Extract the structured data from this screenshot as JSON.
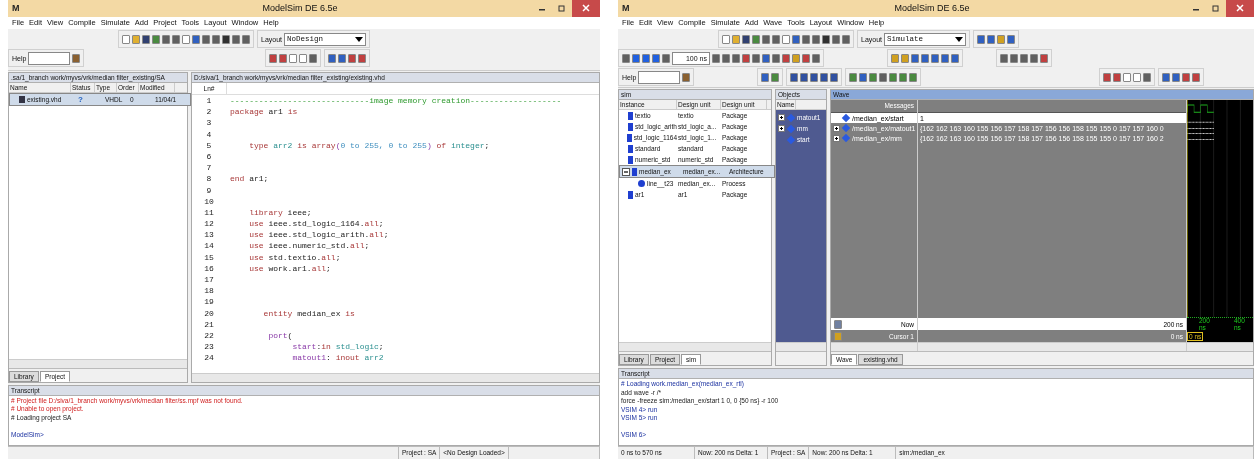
{
  "left": {
    "window": {
      "logo": "M",
      "title": "ModelSim DE 6.5e"
    },
    "menu": [
      "File",
      "Edit",
      "View",
      "Compile",
      "Simulate",
      "Add",
      "Project",
      "Tools",
      "Layout",
      "Window",
      "Help"
    ],
    "toolbar": {
      "layout_label": "Layout",
      "layout_value": "NoDesign",
      "help_label": "Help"
    },
    "project": {
      "title": ".sa/1_branch work/myvs/vrk/median filter_existing/SA",
      "columns": [
        "Name",
        "Status",
        "Type",
        "Order",
        "Modified"
      ],
      "rows": [
        {
          "name": "existing.vhd",
          "status": "?",
          "type": "VHDL",
          "order": "0",
          "modified": "11/04/1",
          "selected": true
        }
      ]
    },
    "tabs": [
      {
        "label": "Library",
        "selected": false
      },
      {
        "label": "Project",
        "selected": true
      }
    ],
    "editor": {
      "title": "D:/siva/1_branch work/myvs/vrk/median filter_existing/existing.vhd",
      "ln_header": "Ln#",
      "lines": [
        {
          "n": "1",
          "tokens": [
            {
              "text": "-----------------------------image memory creation-------------------",
              "kind": "comment"
            }
          ]
        },
        {
          "n": "2",
          "tokens": [
            {
              "text": "package",
              "kind": "kw"
            },
            {
              "text": " ar1 ",
              "kind": "text"
            },
            {
              "text": "is",
              "kind": "kw"
            }
          ]
        },
        {
          "n": "3"
        },
        {
          "n": "4"
        },
        {
          "n": "5",
          "tokens": [
            {
              "text": "    type",
              "kind": "kw"
            },
            {
              "text": " arr2 ",
              "kind": "type"
            },
            {
              "text": "is",
              "kind": "kw"
            },
            {
              "text": " array",
              "kind": "kw"
            },
            {
              "text": "(",
              "kind": "port"
            },
            {
              "text": "0 to 255, 0 to 255",
              "kind": "num"
            },
            {
              "text": ")",
              "kind": "port"
            },
            {
              "text": " of",
              "kind": "kw"
            },
            {
              "text": " integer",
              "kind": "type"
            },
            {
              "text": ";",
              "kind": "text"
            }
          ]
        },
        {
          "n": "6"
        },
        {
          "n": "7"
        },
        {
          "n": "8",
          "tokens": [
            {
              "text": "end",
              "kind": "kw"
            },
            {
              "text": " ar1;",
              "kind": "text"
            }
          ]
        },
        {
          "n": "9"
        },
        {
          "n": "10"
        },
        {
          "n": "11",
          "tokens": [
            {
              "text": "    library",
              "kind": "kw"
            },
            {
              "text": " ieee;",
              "kind": "text"
            }
          ]
        },
        {
          "n": "12",
          "tokens": [
            {
              "text": "    use",
              "kind": "kw"
            },
            {
              "text": " ieee.std_logic_1164.",
              "kind": "text"
            },
            {
              "text": "all",
              "kind": "kw"
            },
            {
              "text": ";",
              "kind": "text"
            }
          ]
        },
        {
          "n": "13",
          "tokens": [
            {
              "text": "    use",
              "kind": "kw"
            },
            {
              "text": " ieee.std_logic_arith.",
              "kind": "text"
            },
            {
              "text": "all",
              "kind": "kw"
            },
            {
              "text": ";",
              "kind": "text"
            }
          ]
        },
        {
          "n": "14",
          "tokens": [
            {
              "text": "    use",
              "kind": "kw"
            },
            {
              "text": " ieee.numeric_std.",
              "kind": "text"
            },
            {
              "text": "all",
              "kind": "kw"
            },
            {
              "text": ";",
              "kind": "text"
            }
          ]
        },
        {
          "n": "15",
          "tokens": [
            {
              "text": "    use",
              "kind": "kw"
            },
            {
              "text": " std.textio.",
              "kind": "text"
            },
            {
              "text": "all",
              "kind": "kw"
            },
            {
              "text": ";",
              "kind": "text"
            }
          ]
        },
        {
          "n": "16",
          "tokens": [
            {
              "text": "    use",
              "kind": "kw"
            },
            {
              "text": " work.ar1.",
              "kind": "text"
            },
            {
              "text": "all",
              "kind": "kw"
            },
            {
              "text": ";",
              "kind": "text"
            }
          ]
        },
        {
          "n": "17"
        },
        {
          "n": "18"
        },
        {
          "n": "19"
        },
        {
          "n": "20",
          "tokens": [
            {
              "text": "       entity",
              "kind": "kw"
            },
            {
              "text": " median_ex ",
              "kind": "text"
            },
            {
              "text": "is",
              "kind": "kw"
            }
          ]
        },
        {
          "n": "21"
        },
        {
          "n": "22",
          "tokens": [
            {
              "text": "        port",
              "kind": "port"
            },
            {
              "text": "(",
              "kind": "text"
            }
          ]
        },
        {
          "n": "23",
          "tokens": [
            {
              "text": "             start",
              "kind": "port"
            },
            {
              "text": ":",
              "kind": "text"
            },
            {
              "text": "in",
              "kind": "kw"
            },
            {
              "text": " std_logic",
              "kind": "type"
            },
            {
              "text": ";",
              "kind": "text"
            }
          ]
        },
        {
          "n": "24",
          "tokens": [
            {
              "text": "             matout1",
              "kind": "port"
            },
            {
              "text": ": ",
              "kind": "text"
            },
            {
              "text": "inout",
              "kind": "kw"
            },
            {
              "text": " arr2",
              "kind": "type"
            }
          ]
        }
      ]
    },
    "transcript": {
      "title": "Transcript",
      "lines": [
        {
          "text": "# Project file D:/siva/1_branch work/myvs/vrk/median filter/ss.mpf was not found.",
          "kind": "error"
        },
        {
          "text": "# Unable to open project.",
          "kind": "error"
        },
        {
          "text": "# Loading project SA",
          "kind": "info"
        },
        {
          "kind": "blank"
        },
        {
          "text": "ModelSim>",
          "kind": "prompt"
        }
      ]
    },
    "status": [
      "Project : SA",
      "<No Design Loaded>"
    ]
  },
  "right": {
    "window": {
      "logo": "M",
      "title": "ModelSim DE 6.5e"
    },
    "menu": [
      "File",
      "Edit",
      "View",
      "Compile",
      "Simulate",
      "Add",
      "Wave",
      "Tools",
      "Layout",
      "Window",
      "Help"
    ],
    "toolbar": {
      "layout_label": "Layout",
      "layout_value": "Simulate",
      "run_length": "100 ns",
      "help_label": "Help"
    },
    "sim": {
      "title": "sim",
      "columns": [
        "Instance",
        "Design unit",
        "Design unit"
      ],
      "rows": [
        {
          "instance": "textio",
          "unit": "textio",
          "type": "Package",
          "selected": false
        },
        {
          "instance": "std_logic_arith",
          "unit": "std_logic_a...",
          "type": "Package",
          "selected": false
        },
        {
          "instance": "std_logic_1164",
          "unit": "std_logic_1...",
          "type": "Package",
          "selected": false
        },
        {
          "instance": "standard",
          "unit": "standard",
          "type": "Package",
          "selected": false
        },
        {
          "instance": "numeric_std",
          "unit": "numeric_std",
          "type": "Package",
          "selected": false
        },
        {
          "instance": "median_ex",
          "unit": "median_ex...",
          "type": "Architecture",
          "selected": true,
          "expanded": true,
          "children": [
            {
              "instance": "line__t23",
              "unit": "median_ex...",
              "type": "Process",
              "selected": false
            }
          ]
        },
        {
          "instance": "ar1",
          "unit": "ar1",
          "type": "Package",
          "selected": false
        }
      ]
    },
    "objects": {
      "title": "Objects",
      "column": "Name",
      "items": [
        {
          "name": "matout1",
          "kind": "array"
        },
        {
          "name": "mm",
          "kind": "array"
        },
        {
          "name": "start",
          "kind": "scalar"
        }
      ]
    },
    "wave": {
      "title": "Wave",
      "messages": "Messages",
      "signals": [
        {
          "name": "/median_ex/start",
          "value": "1",
          "kind": "scalar"
        },
        {
          "name": "/median_ex/matout1",
          "value": "{162 162 163 160 155 156 157 158 157 156 156 158 155 155 0 157 157 160 0",
          "kind": "array"
        },
        {
          "name": "/median_ex/mm",
          "value": "{162 162 163 160 155 156 157 158 157 156 156 158 155 155 0 157 157 160 2",
          "kind": "array"
        }
      ],
      "now_label": "Now",
      "now_value": "200 ns",
      "cursor_label": "Cursor 1",
      "cursor_value": "0 ns",
      "cursor_tag": "0 ns",
      "timeline": [
        "200 ns",
        "400 ns"
      ]
    },
    "left_tabs": [
      {
        "label": "Library",
        "selected": false
      },
      {
        "label": "Project",
        "selected": false
      },
      {
        "label": "sim",
        "selected": true
      }
    ],
    "wave_tabs": [
      {
        "label": "Wave",
        "selected": true
      },
      {
        "label": "existing.vhd",
        "selected": false
      }
    ],
    "transcript": {
      "title": "Transcript",
      "lines": [
        {
          "text": "# Loading work.median_ex(median_ex_rtl)",
          "kind": "prompt"
        },
        {
          "text": "add wave -r /*",
          "kind": "info"
        },
        {
          "text": "force -freeze sim:/median_ex/start 1 0, 0 {50 ns} -r 100",
          "kind": "info"
        },
        {
          "text": "VSIM 4> run",
          "kind": "prompt"
        },
        {
          "text": "VSIM 5> run",
          "kind": "prompt"
        },
        {
          "kind": "blank"
        },
        {
          "text": "VSIM 6>",
          "kind": "prompt"
        }
      ]
    },
    "status": [
      "0 ns to 570 ns",
      "Now: 200 ns  Delta: 1",
      "Project : SA",
      "Now: 200 ns  Delta: 1",
      "sim:/median_ex"
    ]
  }
}
